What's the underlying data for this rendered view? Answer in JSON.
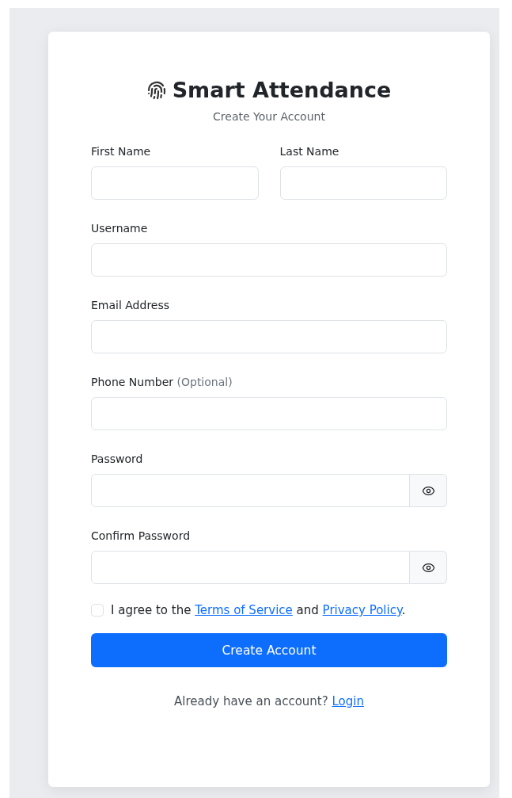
{
  "brand": {
    "title": "Smart Attendance",
    "subtitle": "Create Your Account"
  },
  "name_row": [
    {
      "label": "First Name",
      "kind": "text"
    },
    {
      "label": "Last Name",
      "kind": "text"
    }
  ],
  "fields": [
    {
      "label": "Username",
      "kind": "text"
    },
    {
      "label": "Email Address",
      "kind": "text"
    },
    {
      "label": "Phone Number",
      "note": "(Optional)",
      "kind": "text"
    },
    {
      "label": "Password",
      "kind": "password"
    },
    {
      "label": "Confirm Password",
      "kind": "password"
    }
  ],
  "agreement": {
    "checked": false,
    "before": "I agree to the",
    "terms_link": "Terms of Service",
    "middle": "and",
    "privacy_link": "Privacy Policy",
    "after": "."
  },
  "submit": "Create Account",
  "footer": {
    "text": "Already have an account?",
    "link": "Login"
  }
}
